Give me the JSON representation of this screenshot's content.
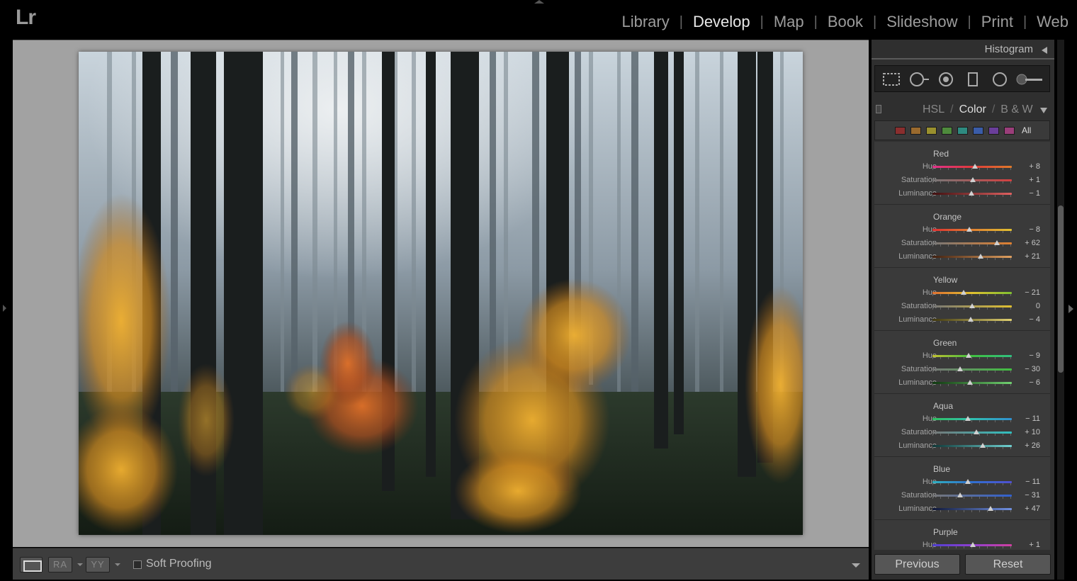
{
  "app": {
    "logo": "Lr"
  },
  "modules": [
    {
      "label": "Library",
      "active": false
    },
    {
      "label": "Develop",
      "active": true
    },
    {
      "label": "Map",
      "active": false
    },
    {
      "label": "Book",
      "active": false
    },
    {
      "label": "Slideshow",
      "active": false
    },
    {
      "label": "Print",
      "active": false
    },
    {
      "label": "Web",
      "active": false
    }
  ],
  "panel": {
    "histogram_title": "Histogram",
    "hsl_tabs": [
      "HSL",
      "Color",
      "B & W"
    ],
    "active_tab": "Color",
    "swatches_all_label": "All",
    "swatches": [
      "#8a2e2e",
      "#9a6a2e",
      "#9a902e",
      "#4e8a3c",
      "#2e8a80",
      "#3a5ca8",
      "#6a3e9a",
      "#9a3e7a"
    ],
    "groups": [
      {
        "name": "Red",
        "color": "#e05050",
        "rows": [
          {
            "label": "Hue",
            "value": "+ 8",
            "num": 8,
            "gradient": "linear-gradient(90deg,#e0308a,#e03a3a,#e07a2a)"
          },
          {
            "label": "Saturation",
            "value": "+ 1",
            "num": 1,
            "gradient": "linear-gradient(90deg,#777,#d44040)"
          },
          {
            "label": "Luminance",
            "value": "− 1",
            "num": -1,
            "gradient": "linear-gradient(90deg,#401010,#e06060)"
          }
        ]
      },
      {
        "name": "Orange",
        "rows": [
          {
            "label": "Hue",
            "value": "− 8",
            "num": -8,
            "gradient": "linear-gradient(90deg,#e03030,#e08030,#e0c030)"
          },
          {
            "label": "Saturation",
            "value": "+ 62",
            "num": 62,
            "gradient": "linear-gradient(90deg,#777,#e08030)"
          },
          {
            "label": "Luminance",
            "value": "+ 21",
            "num": 21,
            "gradient": "linear-gradient(90deg,#402010,#e0a060)"
          }
        ]
      },
      {
        "name": "Yellow",
        "rows": [
          {
            "label": "Hue",
            "value": "− 21",
            "num": -21,
            "gradient": "linear-gradient(90deg,#e07030,#e0c030,#80c030)"
          },
          {
            "label": "Saturation",
            "value": "0",
            "num": 0,
            "gradient": "linear-gradient(90deg,#777,#e0c030)"
          },
          {
            "label": "Luminance",
            "value": "− 4",
            "num": -4,
            "gradient": "linear-gradient(90deg,#403810,#e0d070)"
          }
        ]
      },
      {
        "name": "Green",
        "rows": [
          {
            "label": "Hue",
            "value": "− 9",
            "num": -9,
            "gradient": "linear-gradient(90deg,#c0c030,#40c040,#30c080)"
          },
          {
            "label": "Saturation",
            "value": "− 30",
            "num": -30,
            "gradient": "linear-gradient(90deg,#777,#40c040)"
          },
          {
            "label": "Luminance",
            "value": "− 6",
            "num": -6,
            "gradient": "linear-gradient(90deg,#103810,#70d070)"
          }
        ]
      },
      {
        "name": "Aqua",
        "rows": [
          {
            "label": "Hue",
            "value": "− 11",
            "num": -11,
            "gradient": "linear-gradient(90deg,#30c060,#30c0b0,#3090d0)"
          },
          {
            "label": "Saturation",
            "value": "+ 10",
            "num": 10,
            "gradient": "linear-gradient(90deg,#777,#30c0c0)"
          },
          {
            "label": "Luminance",
            "value": "+ 26",
            "num": 26,
            "gradient": "linear-gradient(90deg,#103838,#70d0d0)"
          }
        ]
      },
      {
        "name": "Blue",
        "rows": [
          {
            "label": "Hue",
            "value": "− 11",
            "num": -11,
            "gradient": "linear-gradient(90deg,#30b0c0,#3070d0,#5050d0)"
          },
          {
            "label": "Saturation",
            "value": "− 31",
            "num": -31,
            "gradient": "linear-gradient(90deg,#777,#3060d0)"
          },
          {
            "label": "Luminance",
            "value": "+ 47",
            "num": 47,
            "gradient": "linear-gradient(90deg,#101838,#7090e0)"
          }
        ]
      },
      {
        "name": "Purple",
        "rows": [
          {
            "label": "Hue",
            "value": "+ 1",
            "num": 1,
            "gradient": "linear-gradient(90deg,#5040d0,#9040d0,#d040a0)"
          }
        ]
      }
    ],
    "previous_label": "Previous",
    "reset_label": "Reset"
  },
  "toolbar": {
    "view2_label": "RA",
    "view3_label": "YY",
    "soft_proofing_label": "Soft Proofing"
  }
}
